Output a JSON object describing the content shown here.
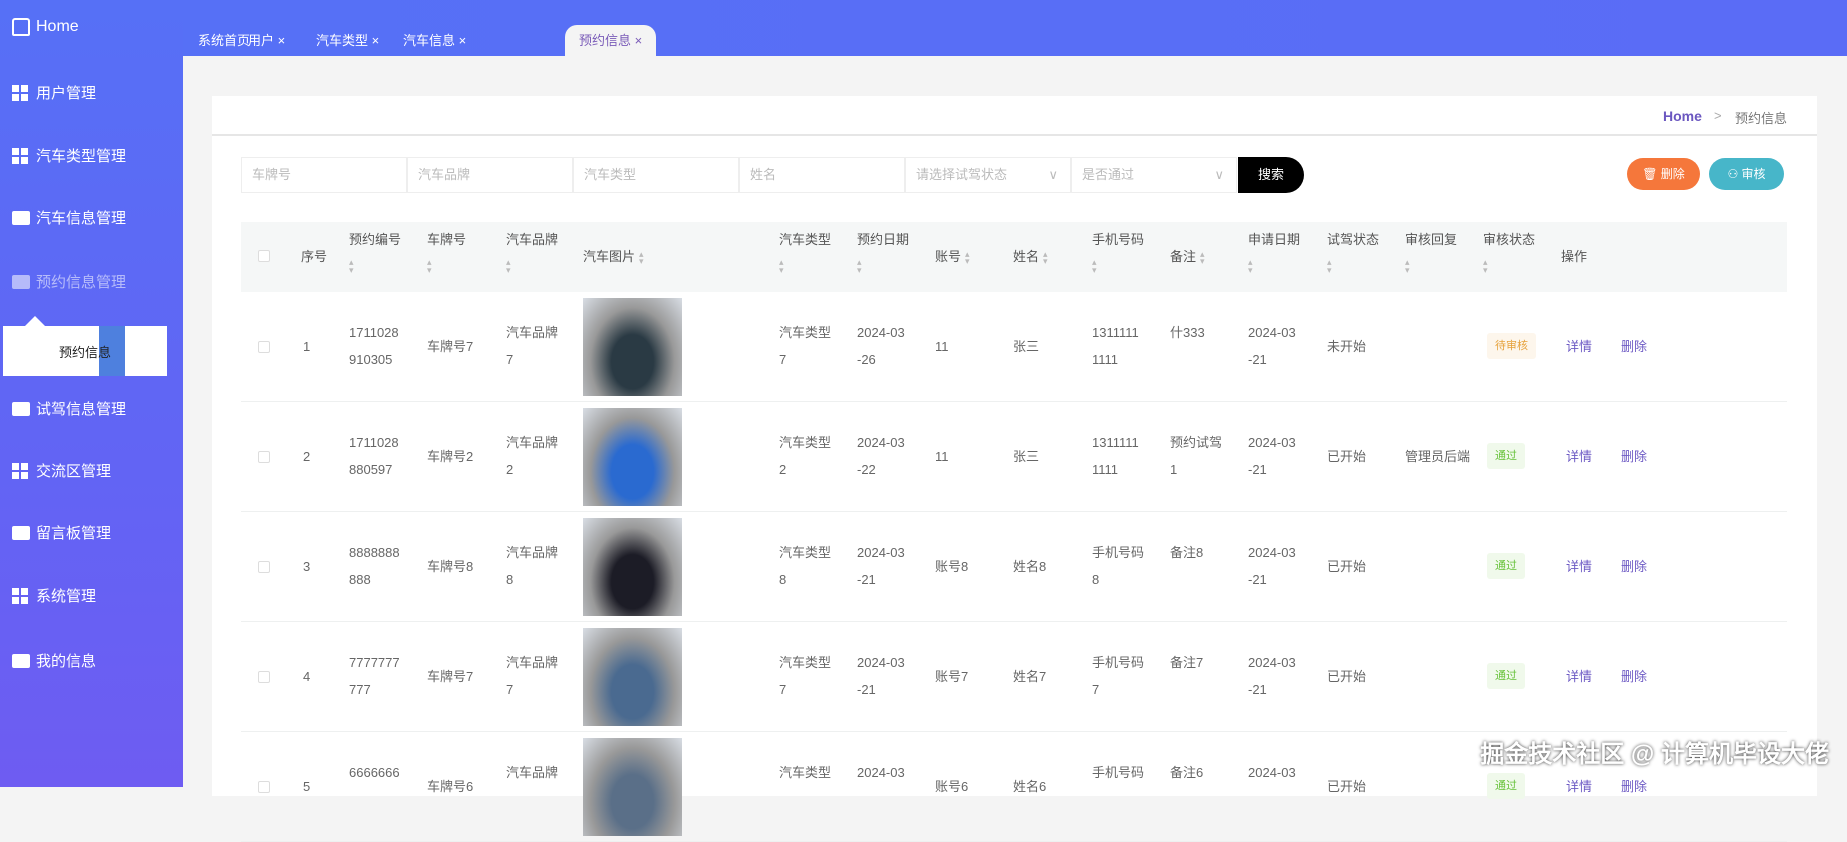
{
  "sidebar": {
    "home": "Home",
    "items": [
      "用户管理",
      "汽车类型管理",
      "汽车信息管理",
      "预约信息管理",
      "试驾信息管理",
      "交流区管理",
      "留言板管理",
      "系统管理",
      "我的信息"
    ],
    "submenu": "预约信息"
  },
  "tabs": [
    {
      "label": "系统首页"
    },
    {
      "label": "用户 ×"
    },
    {
      "label": "汽车类型 ×"
    },
    {
      "label": "汽车信息 ×"
    },
    {
      "label": "预约信息 ×",
      "active": true
    }
  ],
  "breadcrumb": {
    "home": "Home",
    "sep": ">",
    "current": "预约信息"
  },
  "search": {
    "fields": [
      "车牌号",
      "汽车品牌",
      "汽车类型",
      "姓名"
    ],
    "selects": [
      "请选择试驾状态",
      "是否通过"
    ],
    "button": "搜索"
  },
  "actions": {
    "delete": "删除",
    "audit": "审核"
  },
  "table": {
    "headers": [
      "序号",
      "预约编号",
      "车牌号",
      "汽车品牌",
      "汽车图片",
      "汽车类型",
      "预约日期",
      "账号",
      "姓名",
      "手机号码",
      "备注",
      "申请日期",
      "试驾状态",
      "审核回复",
      "审核状态",
      "操作"
    ],
    "row_actions": {
      "detail": "详情",
      "delete": "删除"
    },
    "rows": [
      {
        "idx": "1",
        "no": [
          "1711028",
          "910305"
        ],
        "plate": "车牌号7",
        "brand": [
          "汽车品牌",
          "7"
        ],
        "type": [
          "汽车类型",
          "7"
        ],
        "date": [
          "2024-03",
          "-26"
        ],
        "account": "11",
        "name": "张三",
        "phone": [
          "1311111",
          "1111"
        ],
        "note": [
          "什333",
          ""
        ],
        "apply": [
          "2024-03",
          "-21"
        ],
        "drive": "未开始",
        "reply": "",
        "status": "待审核",
        "img": "#2a3a44"
      },
      {
        "idx": "2",
        "no": [
          "1711028",
          "880597"
        ],
        "plate": "车牌号2",
        "brand": [
          "汽车品牌",
          "2"
        ],
        "type": [
          "汽车类型",
          "2"
        ],
        "date": [
          "2024-03",
          "-22"
        ],
        "account": "11",
        "name": "张三",
        "phone": [
          "1311111",
          "1111"
        ],
        "note": [
          "预约试驾",
          "1"
        ],
        "apply": [
          "2024-03",
          "-21"
        ],
        "drive": "已开始",
        "reply": "管理员后端",
        "status": "通过",
        "img": "#2a6ad0"
      },
      {
        "idx": "3",
        "no": [
          "8888888",
          "888"
        ],
        "plate": "车牌号8",
        "brand": [
          "汽车品牌",
          "8"
        ],
        "type": [
          "汽车类型",
          "8"
        ],
        "date": [
          "2024-03",
          "-21"
        ],
        "account": "账号8",
        "name": "姓名8",
        "phone": [
          "手机号码",
          "8"
        ],
        "note": [
          "备注8",
          ""
        ],
        "apply": [
          "2024-03",
          "-21"
        ],
        "drive": "已开始",
        "reply": "",
        "status": "通过",
        "img": "#1c1c26"
      },
      {
        "idx": "4",
        "no": [
          "7777777",
          "777"
        ],
        "plate": "车牌号7",
        "brand": [
          "汽车品牌",
          "7"
        ],
        "type": [
          "汽车类型",
          "7"
        ],
        "date": [
          "2024-03",
          "-21"
        ],
        "account": "账号7",
        "name": "姓名7",
        "phone": [
          "手机号码",
          "7"
        ],
        "note": [
          "备注7",
          ""
        ],
        "apply": [
          "2024-03",
          "-21"
        ],
        "drive": "已开始",
        "reply": "",
        "status": "通过",
        "img": "#4a6a90"
      },
      {
        "idx": "5",
        "no": [
          "6666666",
          ""
        ],
        "plate": "车牌号6",
        "brand": [
          "汽车品牌",
          ""
        ],
        "type": [
          "汽车类型",
          ""
        ],
        "date": [
          "2024-03",
          ""
        ],
        "account": "账号6",
        "name": "姓名6",
        "phone": [
          "手机号码",
          ""
        ],
        "note": [
          "备注6",
          ""
        ],
        "apply": [
          "2024-03",
          ""
        ],
        "drive": "已开始",
        "reply": "",
        "status": "通过",
        "img": "#5a6f88"
      }
    ]
  },
  "watermark": "掘金技术社区 @ 计算机毕设大佬"
}
